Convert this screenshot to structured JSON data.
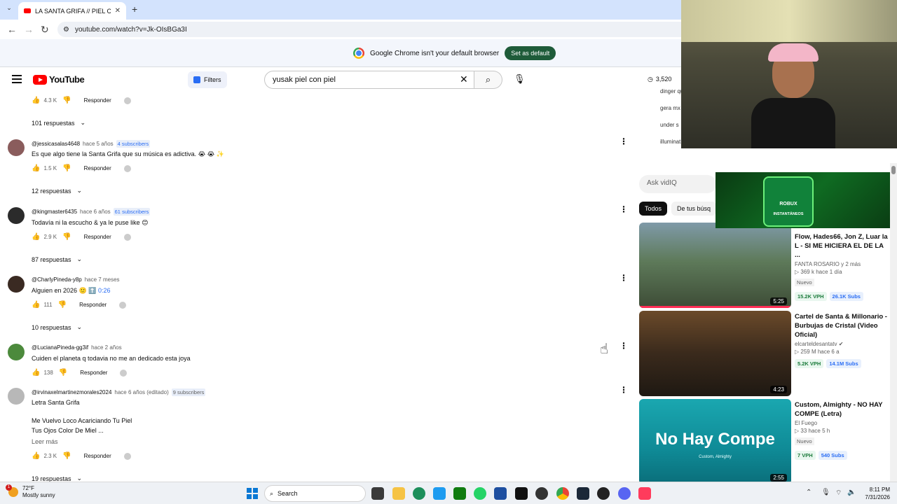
{
  "browser": {
    "tab_title": "LA SANTA GRIFA // PIEL CON P",
    "tab_close": "✕",
    "new_tab": "+",
    "url": "youtube.com/watch?v=Jk-OIsBGa3I",
    "infobar_text": "Google Chrome isn't your default browser",
    "set_default_label": "Set as default"
  },
  "youtube": {
    "logo_text": "YouTube",
    "filters_label": "Filters",
    "search_value": "yusak piel con piel",
    "view_count": "3,520"
  },
  "comments": {
    "top_actions": {
      "likes": "4.3 K",
      "reply": "Responder"
    },
    "top_replies": "101 respuestas",
    "items": [
      {
        "author": "@jessicasalas4648",
        "ago": "hace 5 años",
        "subs": "4 subscribers",
        "text": "Es que algo tiene la Santa Grifa que su música es adictiva. 😭 😭 ✨",
        "likes": "1.5 K",
        "reply": "Responder",
        "replies": "12 respuestas"
      },
      {
        "author": "@kingmaster6435",
        "ago": "hace 6 años",
        "subs": "61 subscribers",
        "text": "Todavía ni la escucho & ya le puse like 😊",
        "likes": "2.9 K",
        "reply": "Responder",
        "replies": "87 respuestas"
      },
      {
        "author": "@CharlyPineda-y8p",
        "ago": "hace 7 meses",
        "subs": "",
        "text": "Alguien en 2026 🙂 ⬆️",
        "timestamp_link": "0:26",
        "likes": "111",
        "reply": "Responder",
        "replies": "10 respuestas"
      },
      {
        "author": "@LucianaPineda-gg3if",
        "ago": "hace 2 años",
        "subs": "",
        "text": "Cuiden el planeta q todavia no me an dedicado esta joya",
        "likes": "138",
        "reply": "Responder"
      },
      {
        "author": "@irvinaxelmartinezmorales2024",
        "ago": "hace 6 años (editado)",
        "subs": "9 subscribers",
        "text_lines": [
          "Letra Santa Grifa",
          "",
          "Me Vuelvo Loco Acariciando Tu Piel",
          "Tus Ojos Color De Miel ..."
        ],
        "read_more": "Leer más",
        "likes": "2.3 K",
        "reply": "Responder",
        "replies": "19 respuestas"
      }
    ]
  },
  "sidebar": {
    "suggestions": [
      "dinger que",
      "gera mx",
      "under s",
      "illuminat"
    ],
    "ask_placeholder": "Ask vidIQ",
    "chips": [
      "Todos",
      "De tus búsq"
    ],
    "videos": [
      {
        "title": "Flow, Hades66, Jon Z, Luar la L - SI ME HICIERA EL DE LA ...",
        "channel": "FANTA ROSARIO",
        "channel_extra": "y 2 más",
        "views": "369 k",
        "ago": "hace 1 día",
        "badge": "Nuevo",
        "vph": "15.2K VPH",
        "subs": "26.1K Subs",
        "duration": "5:25"
      },
      {
        "title": "Cartel de Santa & Millonario - Burbujas de Cristal (Video Oficial)",
        "channel": "elcarteldesantatv",
        "views": "259 M",
        "ago": "hace 6 a",
        "vph": "5.2K VPH",
        "subs": "14.1M Subs",
        "duration": "4:23"
      },
      {
        "title": "Custom, Almighty - NO HAY COMPE (Letra)",
        "channel": "El Fuego",
        "views": "33",
        "ago": "hace 5 h",
        "badge": "Nuevo",
        "vph": "7 VPH",
        "subs": "540 Subs",
        "duration": "2:55",
        "thumb_text": "No Hay Compe",
        "thumb_sub": "Custom, Almighty"
      }
    ]
  },
  "overlay": {
    "ad_text_1": "ROBUX",
    "ad_text_2": "INSTANTÁNEOS"
  },
  "taskbar": {
    "temp": "72°F",
    "weather": "Mostly sunny",
    "weather_badge": "1",
    "search_label": "Search",
    "time": "8:11 PM",
    "date": "7/31/2026"
  },
  "colors": {
    "youtube_red": "#ff0000",
    "chrome_tabbar": "#d3e3fd",
    "set_default_green": "#1e5b39",
    "vph_green": "#1a7a3a",
    "subs_blue": "#2a6df4"
  }
}
